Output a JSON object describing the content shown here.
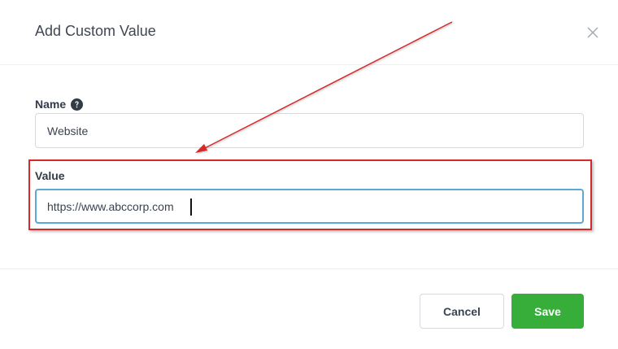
{
  "modal": {
    "title": "Add Custom Value",
    "close_icon": "close-icon"
  },
  "form": {
    "name": {
      "label": "Name",
      "help_icon": "question-circle-icon",
      "value": "Website"
    },
    "value": {
      "label": "Value",
      "value": "https://www.abccorp.com"
    }
  },
  "footer": {
    "cancel_label": "Cancel",
    "save_label": "Save"
  },
  "colors": {
    "save_button": "#38ae3a",
    "focus_border": "#5aa9d6",
    "annotation": "#d42a2a"
  }
}
